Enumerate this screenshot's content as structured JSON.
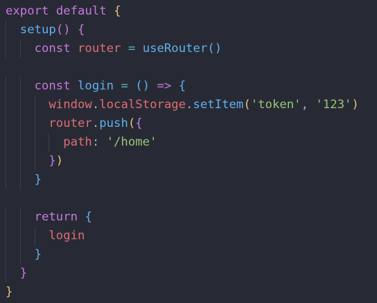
{
  "theme": {
    "background": "#272a34",
    "keyword": "#c678dd",
    "function": "#61afef",
    "variable": "#e06c75",
    "string": "#98c379",
    "operator": "#56b6c2",
    "punctuation": "#abb2bf",
    "bracket_level_1": "#e5c07b",
    "bracket_level_2": "#c678dd",
    "bracket_level_3": "#61afef"
  },
  "code": {
    "language": "javascript",
    "lines": [
      [
        [
          "export",
          "keyword"
        ],
        [
          " ",
          ""
        ],
        [
          "default",
          "keyword"
        ],
        [
          " ",
          ""
        ],
        [
          "{",
          "bracket_level_1"
        ]
      ],
      [
        [
          "setup",
          "function"
        ],
        [
          "()",
          "bracket_level_2"
        ],
        [
          " ",
          ""
        ],
        [
          "{",
          "bracket_level_2"
        ]
      ],
      [
        [
          "const",
          "keyword"
        ],
        [
          " ",
          ""
        ],
        [
          "router",
          "variable"
        ],
        [
          " ",
          ""
        ],
        [
          "=",
          "operator"
        ],
        [
          " ",
          ""
        ],
        [
          "useRouter",
          "function"
        ],
        [
          "()",
          "bracket_level_3"
        ]
      ],
      [],
      [
        [
          "const",
          "keyword"
        ],
        [
          " ",
          ""
        ],
        [
          "login",
          "function"
        ],
        [
          " ",
          ""
        ],
        [
          "=",
          "operator"
        ],
        [
          " ",
          ""
        ],
        [
          "()",
          "bracket_level_3"
        ],
        [
          " ",
          ""
        ],
        [
          "=>",
          "keyword"
        ],
        [
          " ",
          ""
        ],
        [
          "{",
          "bracket_level_3"
        ]
      ],
      [
        [
          "window",
          "variable"
        ],
        [
          ".",
          "punctuation"
        ],
        [
          "localStorage",
          "variable"
        ],
        [
          ".",
          "punctuation"
        ],
        [
          "setItem",
          "function"
        ],
        [
          "(",
          "bracket_level_1"
        ],
        [
          "'token'",
          "string"
        ],
        [
          ",",
          "punctuation"
        ],
        [
          " ",
          ""
        ],
        [
          "'123'",
          "string"
        ],
        [
          ")",
          "bracket_level_1"
        ]
      ],
      [
        [
          "router",
          "variable"
        ],
        [
          ".",
          "punctuation"
        ],
        [
          "push",
          "function"
        ],
        [
          "(",
          "bracket_level_1"
        ],
        [
          "{",
          "bracket_level_2"
        ]
      ],
      [
        [
          "path",
          "variable"
        ],
        [
          ":",
          "punctuation"
        ],
        [
          " ",
          ""
        ],
        [
          "'/home'",
          "string"
        ]
      ],
      [
        [
          "}",
          "bracket_level_2"
        ],
        [
          ")",
          "bracket_level_1"
        ]
      ],
      [
        [
          "}",
          "bracket_level_3"
        ]
      ],
      [],
      [
        [
          "return",
          "keyword"
        ],
        [
          " ",
          ""
        ],
        [
          "{",
          "bracket_level_3"
        ]
      ],
      [
        [
          "login",
          "variable"
        ]
      ],
      [
        [
          "}",
          "bracket_level_3"
        ]
      ],
      [
        [
          "}",
          "bracket_level_2"
        ]
      ],
      [
        [
          "}",
          "bracket_level_1"
        ]
      ]
    ]
  }
}
